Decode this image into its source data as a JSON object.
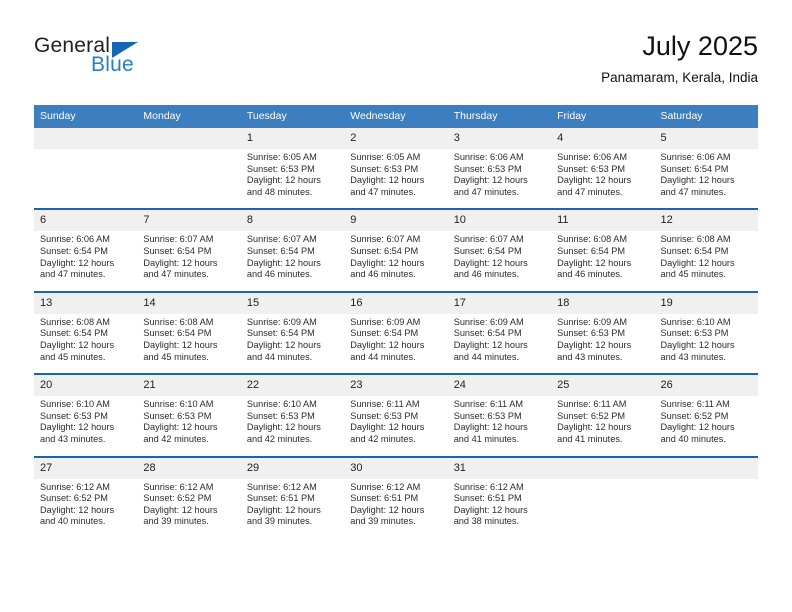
{
  "brand": {
    "name_part1": "General",
    "name_part2": "Blue",
    "triangle_color": "#1567b3",
    "blue_color": "#2580c6"
  },
  "header": {
    "title": "July 2025",
    "subtitle": "Panamaram, Kerala, India"
  },
  "theme": {
    "header_blue": "#3c7ebf",
    "separator_blue": "#1567b3",
    "daynum_band": "#f0f0f0"
  },
  "weekday_headers": [
    "Sunday",
    "Monday",
    "Tuesday",
    "Wednesday",
    "Thursday",
    "Friday",
    "Saturday"
  ],
  "labels": {
    "sunrise_prefix": "Sunrise: ",
    "sunset_prefix": "Sunset: ",
    "daylight_prefix": "Daylight: "
  },
  "weeks": [
    {
      "days": [
        {
          "num": "",
          "sunrise": "",
          "sunset": "",
          "daylight": "",
          "empty": true
        },
        {
          "num": "",
          "sunrise": "",
          "sunset": "",
          "daylight": "",
          "empty": true
        },
        {
          "num": "1",
          "sunrise": "Sunrise: 6:05 AM",
          "sunset": "Sunset: 6:53 PM",
          "daylight": "Daylight: 12 hours and 48 minutes."
        },
        {
          "num": "2",
          "sunrise": "Sunrise: 6:05 AM",
          "sunset": "Sunset: 6:53 PM",
          "daylight": "Daylight: 12 hours and 47 minutes."
        },
        {
          "num": "3",
          "sunrise": "Sunrise: 6:06 AM",
          "sunset": "Sunset: 6:53 PM",
          "daylight": "Daylight: 12 hours and 47 minutes."
        },
        {
          "num": "4",
          "sunrise": "Sunrise: 6:06 AM",
          "sunset": "Sunset: 6:53 PM",
          "daylight": "Daylight: 12 hours and 47 minutes."
        },
        {
          "num": "5",
          "sunrise": "Sunrise: 6:06 AM",
          "sunset": "Sunset: 6:54 PM",
          "daylight": "Daylight: 12 hours and 47 minutes."
        }
      ]
    },
    {
      "days": [
        {
          "num": "6",
          "sunrise": "Sunrise: 6:06 AM",
          "sunset": "Sunset: 6:54 PM",
          "daylight": "Daylight: 12 hours and 47 minutes."
        },
        {
          "num": "7",
          "sunrise": "Sunrise: 6:07 AM",
          "sunset": "Sunset: 6:54 PM",
          "daylight": "Daylight: 12 hours and 47 minutes."
        },
        {
          "num": "8",
          "sunrise": "Sunrise: 6:07 AM",
          "sunset": "Sunset: 6:54 PM",
          "daylight": "Daylight: 12 hours and 46 minutes."
        },
        {
          "num": "9",
          "sunrise": "Sunrise: 6:07 AM",
          "sunset": "Sunset: 6:54 PM",
          "daylight": "Daylight: 12 hours and 46 minutes."
        },
        {
          "num": "10",
          "sunrise": "Sunrise: 6:07 AM",
          "sunset": "Sunset: 6:54 PM",
          "daylight": "Daylight: 12 hours and 46 minutes."
        },
        {
          "num": "11",
          "sunrise": "Sunrise: 6:08 AM",
          "sunset": "Sunset: 6:54 PM",
          "daylight": "Daylight: 12 hours and 46 minutes."
        },
        {
          "num": "12",
          "sunrise": "Sunrise: 6:08 AM",
          "sunset": "Sunset: 6:54 PM",
          "daylight": "Daylight: 12 hours and 45 minutes."
        }
      ]
    },
    {
      "days": [
        {
          "num": "13",
          "sunrise": "Sunrise: 6:08 AM",
          "sunset": "Sunset: 6:54 PM",
          "daylight": "Daylight: 12 hours and 45 minutes."
        },
        {
          "num": "14",
          "sunrise": "Sunrise: 6:08 AM",
          "sunset": "Sunset: 6:54 PM",
          "daylight": "Daylight: 12 hours and 45 minutes."
        },
        {
          "num": "15",
          "sunrise": "Sunrise: 6:09 AM",
          "sunset": "Sunset: 6:54 PM",
          "daylight": "Daylight: 12 hours and 44 minutes."
        },
        {
          "num": "16",
          "sunrise": "Sunrise: 6:09 AM",
          "sunset": "Sunset: 6:54 PM",
          "daylight": "Daylight: 12 hours and 44 minutes."
        },
        {
          "num": "17",
          "sunrise": "Sunrise: 6:09 AM",
          "sunset": "Sunset: 6:54 PM",
          "daylight": "Daylight: 12 hours and 44 minutes."
        },
        {
          "num": "18",
          "sunrise": "Sunrise: 6:09 AM",
          "sunset": "Sunset: 6:53 PM",
          "daylight": "Daylight: 12 hours and 43 minutes."
        },
        {
          "num": "19",
          "sunrise": "Sunrise: 6:10 AM",
          "sunset": "Sunset: 6:53 PM",
          "daylight": "Daylight: 12 hours and 43 minutes."
        }
      ]
    },
    {
      "days": [
        {
          "num": "20",
          "sunrise": "Sunrise: 6:10 AM",
          "sunset": "Sunset: 6:53 PM",
          "daylight": "Daylight: 12 hours and 43 minutes."
        },
        {
          "num": "21",
          "sunrise": "Sunrise: 6:10 AM",
          "sunset": "Sunset: 6:53 PM",
          "daylight": "Daylight: 12 hours and 42 minutes."
        },
        {
          "num": "22",
          "sunrise": "Sunrise: 6:10 AM",
          "sunset": "Sunset: 6:53 PM",
          "daylight": "Daylight: 12 hours and 42 minutes."
        },
        {
          "num": "23",
          "sunrise": "Sunrise: 6:11 AM",
          "sunset": "Sunset: 6:53 PM",
          "daylight": "Daylight: 12 hours and 42 minutes."
        },
        {
          "num": "24",
          "sunrise": "Sunrise: 6:11 AM",
          "sunset": "Sunset: 6:53 PM",
          "daylight": "Daylight: 12 hours and 41 minutes."
        },
        {
          "num": "25",
          "sunrise": "Sunrise: 6:11 AM",
          "sunset": "Sunset: 6:52 PM",
          "daylight": "Daylight: 12 hours and 41 minutes."
        },
        {
          "num": "26",
          "sunrise": "Sunrise: 6:11 AM",
          "sunset": "Sunset: 6:52 PM",
          "daylight": "Daylight: 12 hours and 40 minutes."
        }
      ]
    },
    {
      "days": [
        {
          "num": "27",
          "sunrise": "Sunrise: 6:12 AM",
          "sunset": "Sunset: 6:52 PM",
          "daylight": "Daylight: 12 hours and 40 minutes."
        },
        {
          "num": "28",
          "sunrise": "Sunrise: 6:12 AM",
          "sunset": "Sunset: 6:52 PM",
          "daylight": "Daylight: 12 hours and 39 minutes."
        },
        {
          "num": "29",
          "sunrise": "Sunrise: 6:12 AM",
          "sunset": "Sunset: 6:51 PM",
          "daylight": "Daylight: 12 hours and 39 minutes."
        },
        {
          "num": "30",
          "sunrise": "Sunrise: 6:12 AM",
          "sunset": "Sunset: 6:51 PM",
          "daylight": "Daylight: 12 hours and 39 minutes."
        },
        {
          "num": "31",
          "sunrise": "Sunrise: 6:12 AM",
          "sunset": "Sunset: 6:51 PM",
          "daylight": "Daylight: 12 hours and 38 minutes."
        },
        {
          "num": "",
          "sunrise": "",
          "sunset": "",
          "daylight": "",
          "empty": true
        },
        {
          "num": "",
          "sunrise": "",
          "sunset": "",
          "daylight": "",
          "empty": true
        }
      ]
    }
  ]
}
